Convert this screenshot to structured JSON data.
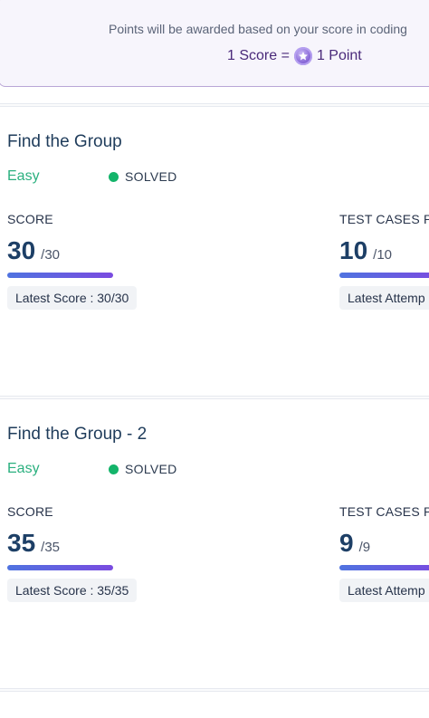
{
  "points_banner": {
    "note": "Points will be awarded based on your score in coding",
    "rate_left": "1 Score =",
    "rate_right": "1 Point",
    "coin_icon": "star-coin-icon"
  },
  "problems": [
    {
      "title": "Find the Group",
      "difficulty": "Easy",
      "status": "SOLVED",
      "score_label": "SCORE",
      "score": "30",
      "score_total": "/30",
      "score_progress": 1.0,
      "latest_score": "Latest Score : 30/30",
      "tests_label": "TEST CASES P",
      "tests": "10",
      "tests_total": "/10",
      "tests_progress": 1.0,
      "latest_attempt": "Latest Attemp"
    },
    {
      "title": "Find the Group - 2",
      "difficulty": "Easy",
      "status": "SOLVED",
      "score_label": "SCORE",
      "score": "35",
      "score_total": "/35",
      "score_progress": 1.0,
      "latest_score": "Latest Score : 35/35",
      "tests_label": "TEST CASES P",
      "tests": "9",
      "tests_total": "/9",
      "tests_progress": 1.0,
      "latest_attempt": "Latest Attemp"
    }
  ],
  "colors": {
    "difficulty_easy": "#2bb07f",
    "solved_dot": "#13b46a",
    "progress_start": "#4f73e0",
    "progress_end": "#7a4be0"
  }
}
